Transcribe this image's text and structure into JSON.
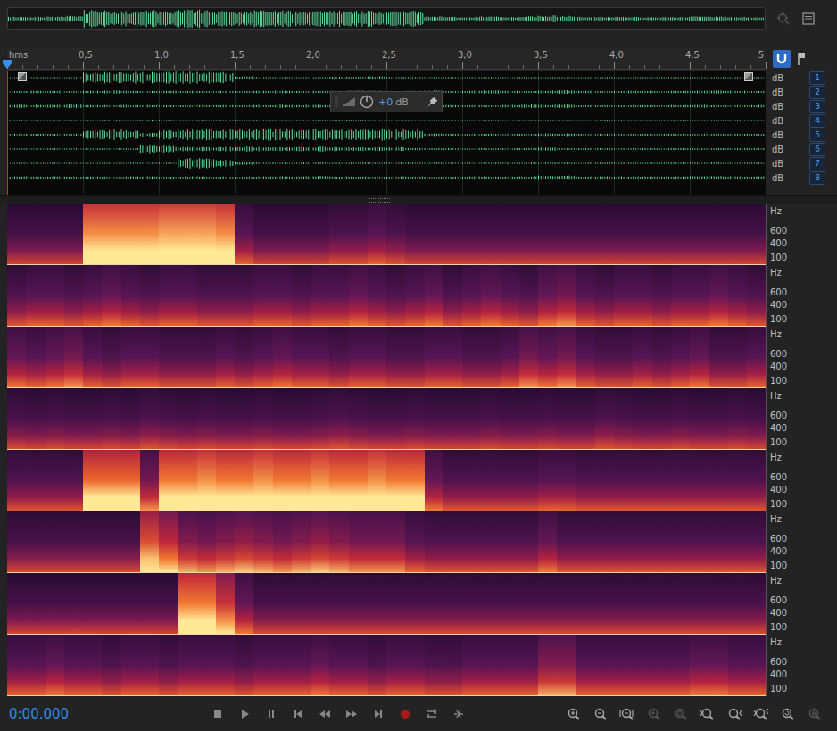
{
  "ruler": {
    "labels": [
      "hms",
      "0,5",
      "1,0",
      "1,5",
      "2,0",
      "2,5",
      "3,0",
      "3,5",
      "4,0",
      "4,5",
      "5"
    ]
  },
  "snapping": {
    "on": true
  },
  "tracks": [
    {
      "number": "1",
      "unit": "dB",
      "envelope": [
        0.1,
        0.1,
        0.1,
        0.1,
        0.9,
        0.9,
        0.9,
        0.9,
        0.95,
        0.95,
        0.95,
        0.9,
        0.2,
        0.1,
        0.1,
        0.1,
        0.1,
        0.15,
        0.15,
        0.2,
        0.15,
        0.1,
        0.1,
        0.1,
        0.1,
        0.1,
        0.1,
        0.1,
        0.1,
        0.1,
        0.1,
        0.1,
        0.1,
        0.1,
        0.1,
        0.1,
        0.1,
        0.1,
        0.1,
        0.1
      ]
    },
    {
      "number": "2",
      "unit": "dB",
      "envelope": [
        0.15,
        0.2,
        0.2,
        0.15,
        0.2,
        0.25,
        0.2,
        0.15,
        0.2,
        0.2,
        0.15,
        0.15,
        0.15,
        0.2,
        0.2,
        0.15,
        0.2,
        0.2,
        0.25,
        0.2,
        0.15,
        0.2,
        0.25,
        0.15,
        0.2,
        0.25,
        0.2,
        0.15,
        0.25,
        0.3,
        0.2,
        0.15,
        0.2,
        0.2,
        0.15,
        0.2,
        0.2,
        0.25,
        0.2,
        0.15
      ]
    },
    {
      "number": "3",
      "unit": "dB",
      "envelope": [
        0.25,
        0.2,
        0.25,
        0.3,
        0.2,
        0.15,
        0.2,
        0.2,
        0.15,
        0.15,
        0.15,
        0.2,
        0.15,
        0.2,
        0.25,
        0.2,
        0.2,
        0.15,
        0.2,
        0.2,
        0.15,
        0.15,
        0.2,
        0.2,
        0.15,
        0.15,
        0.2,
        0.3,
        0.25,
        0.3,
        0.2,
        0.15,
        0.15,
        0.2,
        0.15,
        0.2,
        0.25,
        0.15,
        0.15,
        0.2
      ]
    },
    {
      "number": "4",
      "unit": "dB",
      "envelope": [
        0.12,
        0.1,
        0.12,
        0.1,
        0.1,
        0.12,
        0.1,
        0.15,
        0.12,
        0.1,
        0.12,
        0.1,
        0.1,
        0.12,
        0.1,
        0.1,
        0.12,
        0.15,
        0.12,
        0.1,
        0.1,
        0.12,
        0.1,
        0.1,
        0.1,
        0.12,
        0.1,
        0.1,
        0.12,
        0.1,
        0.1,
        0.15,
        0.12,
        0.1,
        0.1,
        0.12,
        0.1,
        0.1,
        0.12,
        0.1
      ]
    },
    {
      "number": "5",
      "unit": "dB",
      "envelope": [
        0.15,
        0.15,
        0.15,
        0.15,
        0.8,
        0.8,
        0.8,
        0.3,
        0.85,
        0.85,
        0.9,
        0.85,
        0.85,
        0.9,
        0.85,
        0.85,
        0.9,
        0.85,
        0.85,
        0.9,
        0.85,
        0.85,
        0.25,
        0.15,
        0.15,
        0.15,
        0.15,
        0.15,
        0.2,
        0.2,
        0.15,
        0.15,
        0.15,
        0.15,
        0.15,
        0.15,
        0.15,
        0.15,
        0.15,
        0.15
      ]
    },
    {
      "number": "6",
      "unit": "dB",
      "envelope": [
        0.12,
        0.12,
        0.12,
        0.12,
        0.12,
        0.12,
        0.12,
        0.7,
        0.55,
        0.35,
        0.3,
        0.35,
        0.4,
        0.35,
        0.3,
        0.35,
        0.4,
        0.35,
        0.3,
        0.3,
        0.3,
        0.2,
        0.15,
        0.15,
        0.15,
        0.15,
        0.15,
        0.15,
        0.25,
        0.15,
        0.15,
        0.15,
        0.15,
        0.15,
        0.15,
        0.15,
        0.15,
        0.15,
        0.15,
        0.15
      ]
    },
    {
      "number": "7",
      "unit": "dB",
      "envelope": [
        0.1,
        0.1,
        0.1,
        0.1,
        0.1,
        0.1,
        0.1,
        0.1,
        0.1,
        0.85,
        0.85,
        0.6,
        0.25,
        0.12,
        0.12,
        0.12,
        0.12,
        0.12,
        0.12,
        0.12,
        0.12,
        0.12,
        0.12,
        0.12,
        0.12,
        0.12,
        0.12,
        0.12,
        0.12,
        0.12,
        0.12,
        0.12,
        0.12,
        0.12,
        0.12,
        0.12,
        0.12,
        0.12,
        0.12,
        0.12
      ]
    },
    {
      "number": "8",
      "unit": "dB",
      "envelope": [
        0.2,
        0.2,
        0.25,
        0.2,
        0.2,
        0.15,
        0.2,
        0.2,
        0.15,
        0.2,
        0.2,
        0.2,
        0.15,
        0.2,
        0.2,
        0.2,
        0.25,
        0.2,
        0.2,
        0.15,
        0.2,
        0.2,
        0.15,
        0.15,
        0.2,
        0.2,
        0.2,
        0.2,
        0.35,
        0.35,
        0.2,
        0.2,
        0.2,
        0.2,
        0.2,
        0.2,
        0.25,
        0.25,
        0.2,
        0.2
      ]
    }
  ],
  "volume_hud": {
    "value": "+0",
    "unit": "dB"
  },
  "spectral": {
    "axis_labels": [
      "Hz",
      "600",
      "400",
      "100"
    ]
  },
  "transport": {
    "time": "0:00.000",
    "buttons": [
      {
        "kind": "stop"
      },
      {
        "kind": "play"
      },
      {
        "kind": "pause"
      },
      {
        "kind": "to-start"
      },
      {
        "kind": "rewind"
      },
      {
        "kind": "forward"
      },
      {
        "kind": "to-end"
      },
      {
        "kind": "record"
      },
      {
        "kind": "loop"
      },
      {
        "kind": "skip"
      }
    ]
  },
  "zoom_tools": [
    {
      "kind": "zoom-in-amplitude",
      "disabled": false
    },
    {
      "kind": "zoom-out-amplitude",
      "disabled": false
    },
    {
      "kind": "zoom-out-full",
      "disabled": false
    },
    {
      "kind": "zoom-in-time",
      "disabled": true
    },
    {
      "kind": "zoom-selection",
      "disabled": true
    },
    {
      "kind": "zoom-in-left",
      "disabled": false
    },
    {
      "kind": "zoom-in-right",
      "disabled": false
    },
    {
      "kind": "zoom-in-both",
      "disabled": false
    },
    {
      "kind": "zoom-reset",
      "disabled": false
    },
    {
      "kind": "zoom-lock",
      "disabled": true
    }
  ]
}
